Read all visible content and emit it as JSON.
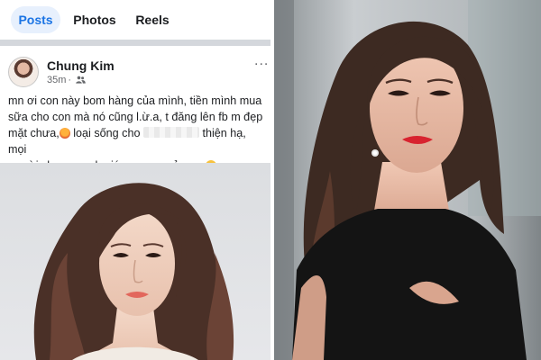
{
  "tabs": [
    {
      "label": "Posts",
      "active": true
    },
    {
      "label": "Photos",
      "active": false
    },
    {
      "label": "Reels",
      "active": false
    }
  ],
  "post": {
    "author": "Chung Kim",
    "time": "35m",
    "audience_icon": "friends-icon",
    "more_label": "...",
    "text_lines": [
      "mn ơi con này bom hàng của mình, tiền mình mua",
      "sữa cho con mà nó cũng l.ừ.a, t đăng lên fb m đẹp",
      "mặt chưa,",
      "loại sống cho",
      "thiện hạ, mọi",
      "người share mạnh giúp em em cảm ơn"
    ],
    "emojis": [
      "angry-face-emoji",
      "kissing-face-emoji"
    ]
  },
  "colors": {
    "accent": "#1b74e4",
    "tab_active_bg": "#e7f0fd",
    "lipstick": "#d8232f",
    "dress": "#141414"
  }
}
